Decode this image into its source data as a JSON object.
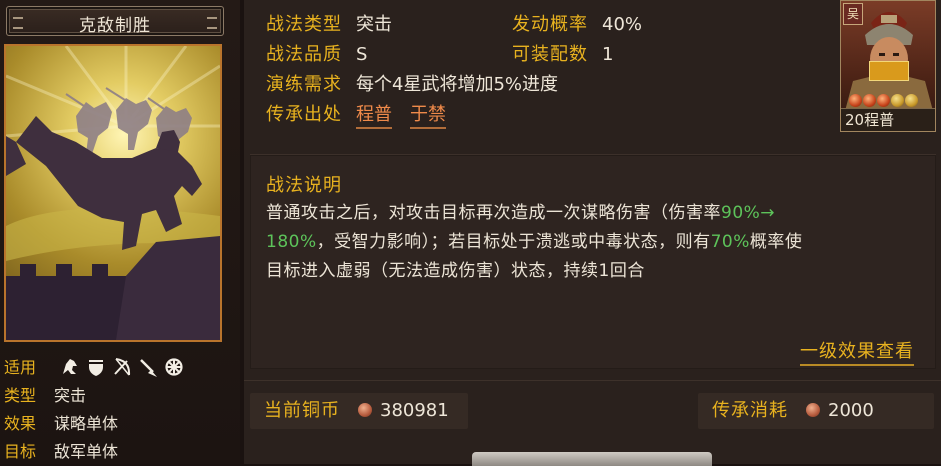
{
  "skill_card": {
    "title": "克敌制胜",
    "applicable_label": "适用",
    "applicable_icons": [
      "cavalry-icon",
      "shield-icon",
      "bow-icon",
      "spear-icon",
      "siege-wheel-icon"
    ],
    "type_label": "类型",
    "type_value": "突击",
    "effect_label": "效果",
    "effect_value": "谋略单体",
    "target_label": "目标",
    "target_value": "敌军单体"
  },
  "info": {
    "type_label": "战法类型",
    "type_value": "突击",
    "trigger_label": "发动概率",
    "trigger_value": "40%",
    "quality_label": "战法品质",
    "quality_value": "S",
    "equip_label": "可装配数",
    "equip_value": "1",
    "training_label": "演练需求",
    "training_value": "每个4星武将增加5%进度",
    "inherit_label": "传承出处",
    "inherit_sources": [
      "程普",
      "于禁"
    ]
  },
  "portrait": {
    "kingdom": "吴",
    "nameplate": "20程普",
    "stars_total": 5,
    "stars_awakened": 3
  },
  "description": {
    "title": "战法说明",
    "line1_a": "普通攻击之后，对攻击目标再次造成一次谋略伤害（伤害率",
    "line1_hl": "90%→",
    "line2_hl": "180%",
    "line2_b": "，受智力影响）；若目标处于溃逃或中毒状态，则有",
    "line2_hl2": "70%",
    "line2_c": "概率使",
    "line3": "目标进入虚弱（无法造成伤害）状态，持续1回合",
    "level_link": "一级效果查看"
  },
  "currency": {
    "coins_label": "当前铜币",
    "coins_value": "380981",
    "cost_label": "传承消耗",
    "cost_value": "2000"
  },
  "colors": {
    "accent_gold": "#e8b21f",
    "highlight_green": "#5dc35a",
    "link_orange": "#ef8a4a",
    "frame_orange": "#b9742c"
  }
}
